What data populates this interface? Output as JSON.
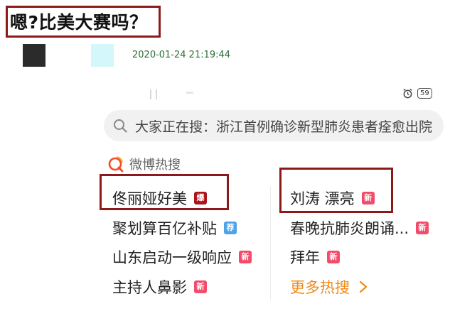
{
  "post": {
    "title": "嗯?比美大赛吗？",
    "timestamp": "2020-01-24 21:19:44"
  },
  "status": {
    "battery": "59",
    "icons": [
      "alarm-clock-icon",
      "battery-icon"
    ]
  },
  "search": {
    "placeholder": "大家正在搜：浙江首例确诊新型肺炎患者痊愈出院"
  },
  "hot_search": {
    "section_title": "微博热搜",
    "left": [
      {
        "label": "佟丽娅好美",
        "badge": "爆"
      },
      {
        "label": "聚划算百亿补贴",
        "badge": "荐"
      },
      {
        "label": "山东启动一级响应",
        "badge": "新"
      },
      {
        "label": "主持人鼻影",
        "badge": "新"
      }
    ],
    "right": [
      {
        "label": "刘涛 漂亮",
        "badge": "新"
      },
      {
        "label": "春晚抗肺炎朗诵...",
        "badge": "新"
      },
      {
        "label": "拜年",
        "badge": "新"
      }
    ],
    "more_label": "更多热搜"
  },
  "colors": {
    "highlight": "#8b1a1a",
    "badge_hot": "#a8161c",
    "badge_new": "#f44b6b",
    "badge_recommend": "#4da3e8",
    "more_link": "#f18b1a",
    "timestamp": "#2a6d3a"
  }
}
